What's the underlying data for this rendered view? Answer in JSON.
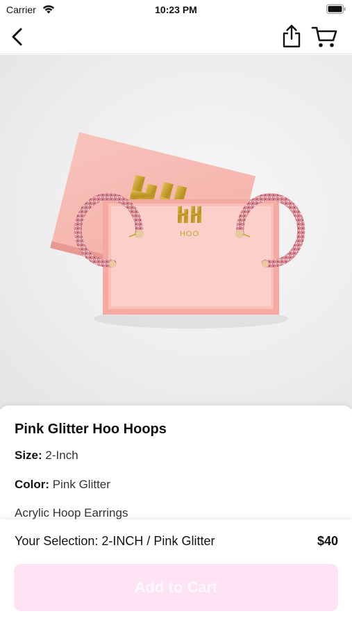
{
  "status_bar": {
    "carrier": "Carrier",
    "time": "10:23 PM"
  },
  "nav": {
    "back_icon": "chevron-left-icon",
    "share_icon": "share-icon",
    "cart_icon": "cart-icon"
  },
  "product_image": {
    "alt": "Pink glitter hoop earrings in pink HOO gift box",
    "brand_mark": "HOO"
  },
  "product": {
    "title": "Pink Glitter Hoo Hoops",
    "size_label": "Size:",
    "size_value": "2-Inch",
    "color_label": "Color:",
    "color_value": "Pink Glitter",
    "description": "Acrylic Hoop Earrings"
  },
  "bottom_bar": {
    "selection_text": "Your Selection: 2-INCH / Pink Glitter",
    "price": "$40",
    "add_to_cart_label": "Add to Cart"
  },
  "colors": {
    "accent_disabled": "#fde3f3",
    "box_pink": "#f6b7b0",
    "gold": "#c9a227"
  }
}
